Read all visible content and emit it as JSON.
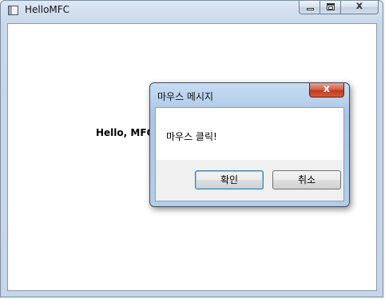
{
  "window": {
    "title": "HelloMFC",
    "icon": "app-window-icon",
    "buttons": {
      "minimize": "minimize-icon",
      "maximize": "maximize-icon",
      "close": "close-icon"
    }
  },
  "client": {
    "text": "Hello, MFC"
  },
  "dialog": {
    "title": "마우스 메시지",
    "message": "마우스 클릭!",
    "close_glyph": "x",
    "ok_label": "확인",
    "cancel_label": "취소"
  },
  "colors": {
    "dialog_close": "#c8412a",
    "frame": "#c9d7ea",
    "default_button_border": "#3c7fb1"
  }
}
